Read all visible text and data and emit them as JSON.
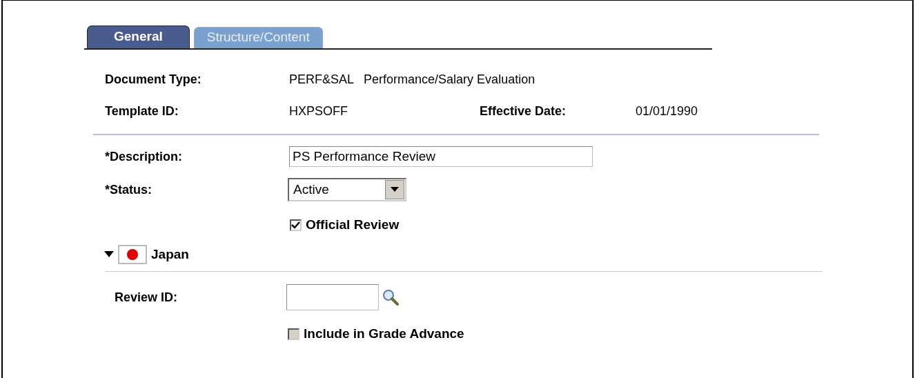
{
  "tabs": [
    {
      "label": "General",
      "selected": true
    },
    {
      "label": "Structure/Content",
      "selected": false
    }
  ],
  "header": {
    "document_type": {
      "label": "Document Type:",
      "code": "PERF&SAL",
      "description": "Performance/Salary Evaluation"
    },
    "template_id": {
      "label": "Template ID:",
      "value": "HXPSOFF"
    },
    "effective_date": {
      "label": "Effective Date:",
      "value": "01/01/1990"
    }
  },
  "description": {
    "label": "*Description:",
    "value": "PS Performance Review"
  },
  "status": {
    "label": "*Status:",
    "value": "Active"
  },
  "official_review": {
    "label": "Official Review",
    "checked": true,
    "disabled": false
  },
  "section": {
    "title": "Japan",
    "expanded": true,
    "review_id": {
      "label": "Review ID:"
    },
    "grade_advance": {
      "label": "Include in Grade Advance",
      "checked": false,
      "disabled": true
    }
  }
}
